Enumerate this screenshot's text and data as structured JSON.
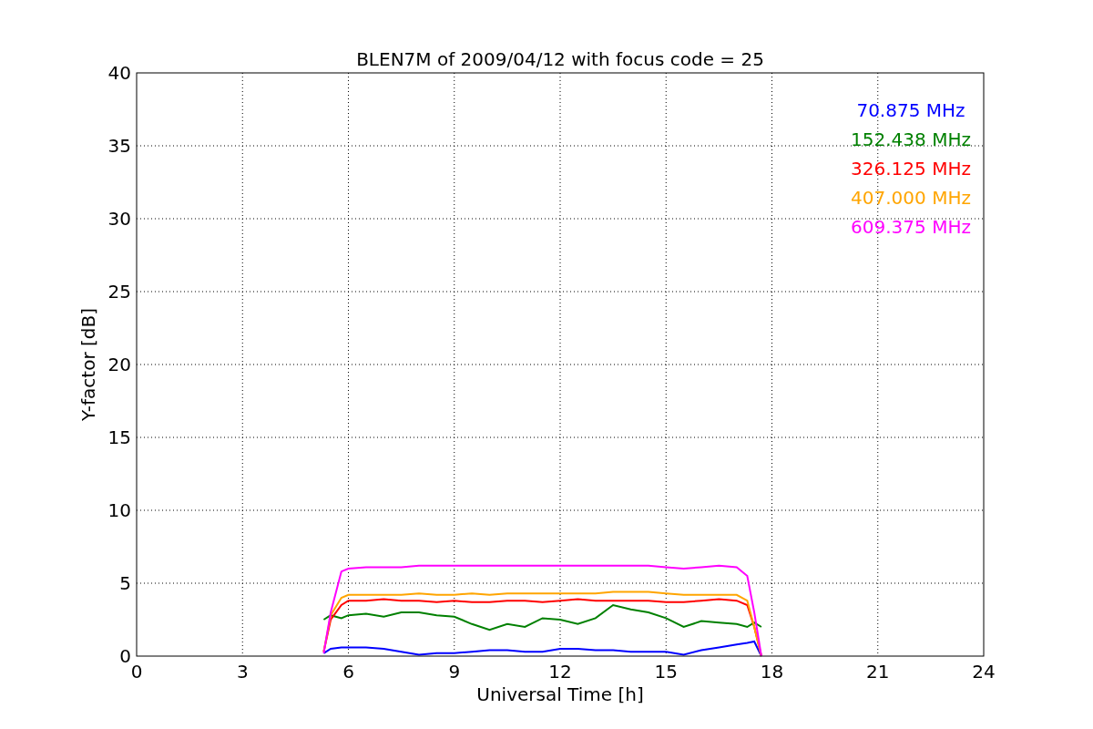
{
  "figure": {
    "chart_data": {
      "type": "line",
      "title": "BLEN7M of 2009/04/12 with focus code = 25",
      "xlabel": "Universal Time [h]",
      "ylabel": "Y-factor [dB]",
      "x": [
        5.3,
        5.5,
        5.8,
        6,
        6.5,
        7,
        7.5,
        8,
        8.5,
        9,
        9.5,
        10,
        10.5,
        11,
        11.5,
        12,
        12.5,
        13,
        13.5,
        14,
        14.5,
        15,
        15.5,
        16,
        16.5,
        17,
        17.3,
        17.5,
        17.7
      ],
      "series": [
        {
          "name": "70.875 MHz",
          "color": "#0000ff",
          "values": [
            0.2,
            0.5,
            0.6,
            0.6,
            0.6,
            0.5,
            0.3,
            0.1,
            0.2,
            0.2,
            0.3,
            0.4,
            0.4,
            0.3,
            0.3,
            0.5,
            0.5,
            0.4,
            0.4,
            0.3,
            0.3,
            0.3,
            0.1,
            0.4,
            0.6,
            0.8,
            0.9,
            1.0,
            0
          ]
        },
        {
          "name": "152.438 MHz",
          "color": "#008000",
          "values": [
            2.5,
            2.8,
            2.6,
            2.8,
            2.9,
            2.7,
            3.0,
            3.0,
            2.8,
            2.7,
            2.2,
            1.8,
            2.2,
            2.0,
            2.6,
            2.5,
            2.2,
            2.6,
            3.5,
            3.2,
            3.0,
            2.6,
            2.0,
            2.4,
            2.3,
            2.2,
            2.0,
            2.3,
            2.0
          ]
        },
        {
          "name": "326.125 MHz",
          "color": "#ff0000",
          "values": [
            0.3,
            2.5,
            3.5,
            3.8,
            3.8,
            3.9,
            3.8,
            3.8,
            3.7,
            3.8,
            3.7,
            3.7,
            3.8,
            3.8,
            3.7,
            3.8,
            3.9,
            3.8,
            3.8,
            3.8,
            3.8,
            3.7,
            3.7,
            3.8,
            3.9,
            3.8,
            3.5,
            2.0,
            0
          ]
        },
        {
          "name": "407.000 MHz",
          "color": "#ffa500",
          "values": [
            0.3,
            2.8,
            4.0,
            4.2,
            4.2,
            4.2,
            4.2,
            4.3,
            4.2,
            4.2,
            4.3,
            4.2,
            4.3,
            4.3,
            4.3,
            4.3,
            4.3,
            4.3,
            4.4,
            4.4,
            4.4,
            4.3,
            4.2,
            4.2,
            4.2,
            4.2,
            3.8,
            2.0,
            0
          ]
        },
        {
          "name": "609.375 MHz",
          "color": "#ff00ff",
          "values": [
            0.2,
            3.0,
            5.8,
            6.0,
            6.1,
            6.1,
            6.1,
            6.2,
            6.2,
            6.2,
            6.2,
            6.2,
            6.2,
            6.2,
            6.2,
            6.2,
            6.2,
            6.2,
            6.2,
            6.2,
            6.2,
            6.1,
            6.0,
            6.1,
            6.2,
            6.1,
            5.5,
            3.0,
            0
          ]
        }
      ],
      "grid": true,
      "xlim": [
        0,
        24
      ],
      "ylim": [
        0,
        40
      ],
      "xticks": [
        0,
        3,
        6,
        9,
        12,
        15,
        18,
        21,
        24
      ],
      "yticks": [
        0,
        5,
        10,
        15,
        20,
        25,
        30,
        35,
        40
      ]
    }
  }
}
